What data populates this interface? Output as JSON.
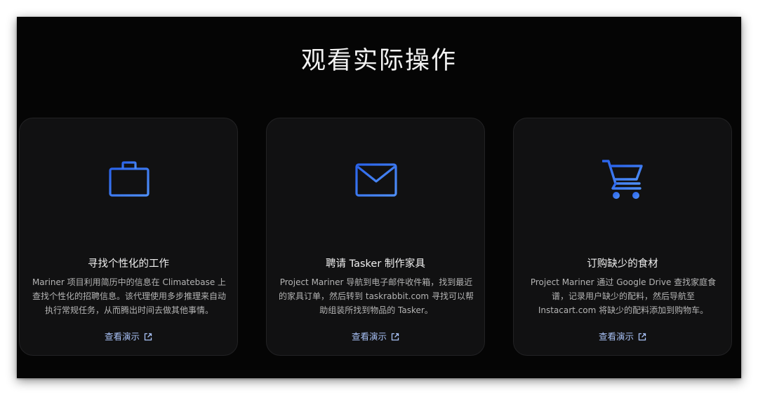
{
  "section": {
    "title": "观看实际操作"
  },
  "cards": [
    {
      "icon": "briefcase-icon",
      "title": "寻找个性化的工作",
      "description": "Mariner 项目利用简历中的信息在 Climatebase 上查找个性化的招聘信息。该代理使用多步推理来自动执行常规任务，从而腾出时间去做其他事情。",
      "link_label": "查看演示"
    },
    {
      "icon": "mail-icon",
      "title": "聘请 Tasker 制作家具",
      "description": "Project Mariner 导航到电子邮件收件箱，找到最近的家具订单，然后转到 taskrabbit.com 寻找可以帮助组装所找到物品的 Tasker。",
      "link_label": "查看演示"
    },
    {
      "icon": "shopping-cart-icon",
      "title": "订购缺少的食材",
      "description": "Project Mariner 通过 Google Drive 查找家庭食谱，记录用户缺少的配料，然后导航至 Instacart.com 将缺少的配料添加到购物车。",
      "link_label": "查看演示"
    }
  ],
  "colors": {
    "background": "#050505",
    "card": "#111112",
    "icon_gradient_start": "#2f6df0",
    "icon_gradient_end": "#4f8ff7",
    "link": "#a9c2f7"
  }
}
